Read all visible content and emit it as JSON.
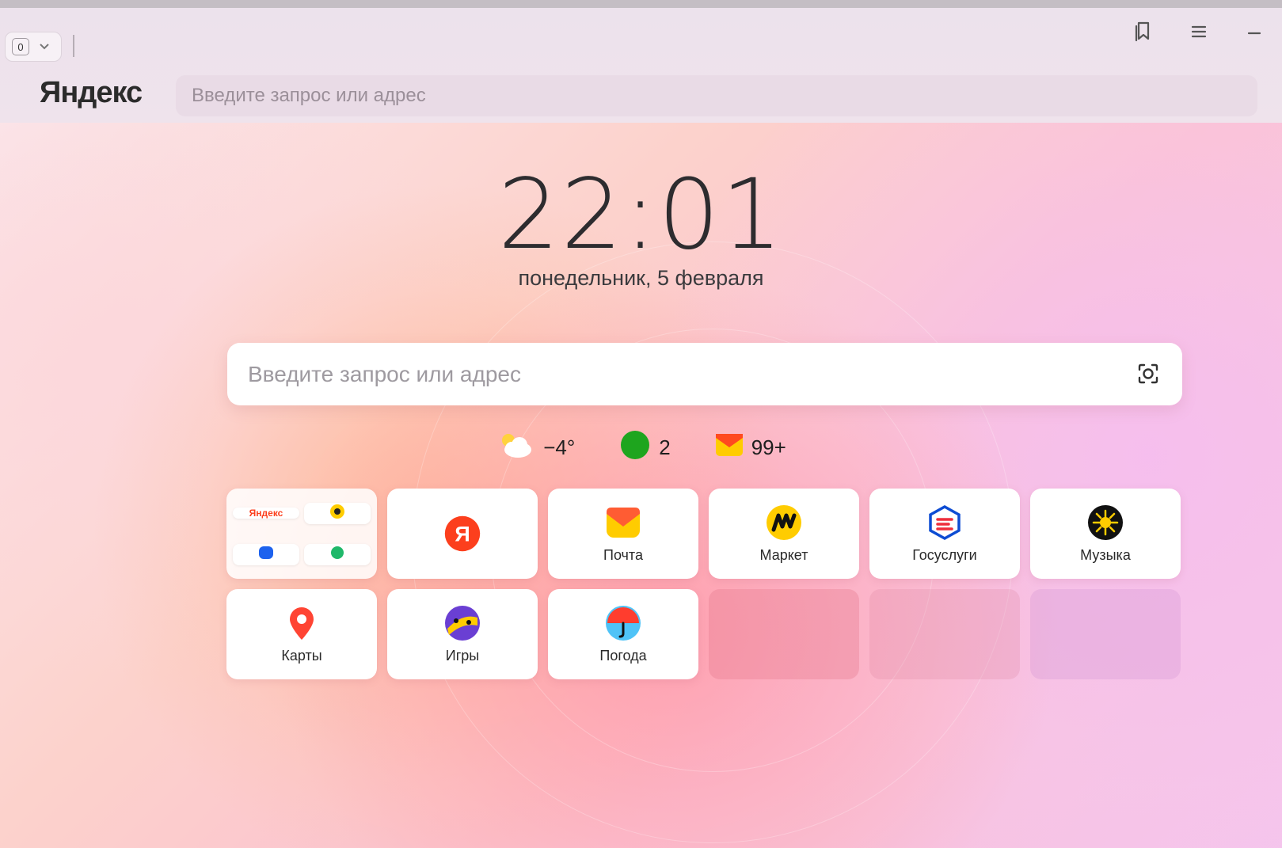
{
  "window": {
    "tab_count": "0",
    "logo_text": "Яндекс",
    "top_search_placeholder": "Введите запрос или адрес"
  },
  "ntp": {
    "clock": "22:01",
    "date": "понедельник, 5 февраля",
    "search_placeholder": "Введите запрос или адрес",
    "informers": {
      "weather": "−4°",
      "traffic": "2",
      "mail": "99+"
    },
    "tiles": [
      {
        "label": "",
        "icon": "yandex-services-group-icon"
      },
      {
        "label": "",
        "icon": "yandex-ya-icon"
      },
      {
        "label": "Почта",
        "icon": "mail-icon"
      },
      {
        "label": "Маркет",
        "icon": "market-icon"
      },
      {
        "label": "Госуслуги",
        "icon": "gosuslugi-icon"
      },
      {
        "label": "Музыка",
        "icon": "music-icon"
      },
      {
        "label": "Карты",
        "icon": "maps-icon"
      },
      {
        "label": "Игры",
        "icon": "games-icon"
      },
      {
        "label": "Погода",
        "icon": "weather-icon"
      },
      {
        "label": "",
        "icon": ""
      },
      {
        "label": "",
        "icon": ""
      },
      {
        "label": "",
        "icon": ""
      }
    ],
    "group_mini": {
      "logo": "Яндекс"
    }
  },
  "colors": {
    "yandex_red": "#fc3f1d",
    "mail_orange": "#ff5c33",
    "market_yellow": "#ffcc00",
    "gosuslugi_blue": "#0d4cd3",
    "traffic_green": "#1ea51e"
  }
}
